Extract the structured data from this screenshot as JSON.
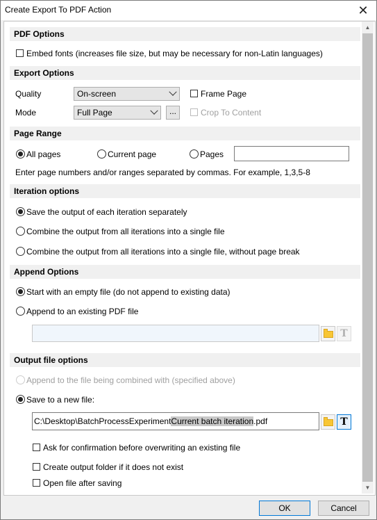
{
  "window": {
    "title": "Create Export To PDF Action",
    "close_glyph": "✕"
  },
  "pdf_options": {
    "header": "PDF Options",
    "embed_fonts": {
      "label": "Embed fonts (increases file size, but may be necessary for non-Latin languages)",
      "checked": false
    }
  },
  "export_options": {
    "header": "Export Options",
    "quality_label": "Quality",
    "quality_value": "On-screen",
    "mode_label": "Mode",
    "mode_value": "Full Page",
    "mode_more_label": "...",
    "frame_page_label": "Frame Page",
    "crop_to_content_label": "Crop To Content"
  },
  "page_range": {
    "header": "Page Range",
    "all_pages": "All pages",
    "current_page": "Current page",
    "pages": "Pages",
    "selected": "All pages",
    "pages_value": "",
    "hint": "Enter page numbers and/or ranges separated by commas. For example, 1,3,5-8"
  },
  "iteration_options": {
    "header": "Iteration options",
    "options": [
      "Save the output of each iteration separately",
      "Combine the output from all iterations into a single file",
      "Combine the output from all iterations into a single file, without page break"
    ],
    "selected_index": 0
  },
  "append_options": {
    "header": "Append Options",
    "start_empty": "Start with an empty file (do not append to existing data)",
    "append_existing": "Append to an existing PDF file",
    "file_path": ""
  },
  "output_file_options": {
    "header": "Output file options",
    "append_combined": "Append to the file being combined with (specified above)",
    "save_new": "Save to a new file:",
    "path_prefix": "C:\\Desktop\\BatchProcessExperiment",
    "path_token": "Current batch iteration",
    "path_suffix": ".pdf",
    "ask_confirm": "Ask for confirmation before overwriting an existing file",
    "create_folder": "Create output folder if it does not exist",
    "open_after": "Open file after saving"
  },
  "buttons": {
    "ok": "OK",
    "cancel": "Cancel"
  },
  "icons": {
    "folder": "folder-icon",
    "text_token": "text-token-icon",
    "text_glyph": "T",
    "up": "▲",
    "down": "▼"
  }
}
